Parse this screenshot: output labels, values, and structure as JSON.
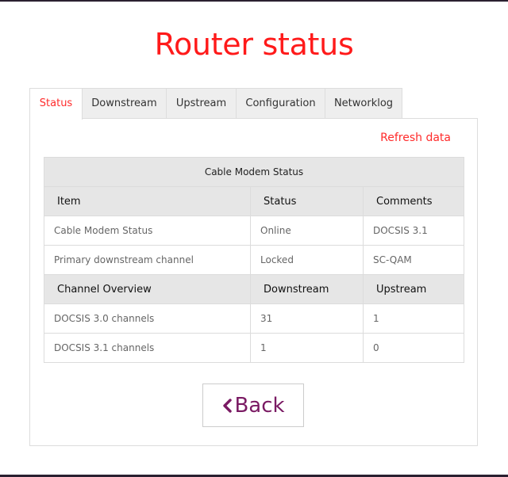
{
  "page": {
    "title": "Router status"
  },
  "tabs": [
    {
      "label": "Status",
      "active": true
    },
    {
      "label": "Downstream",
      "active": false
    },
    {
      "label": "Upstream",
      "active": false
    },
    {
      "label": "Configuration",
      "active": false
    },
    {
      "label": "Networklog",
      "active": false
    }
  ],
  "panel": {
    "refresh_label": "Refresh data"
  },
  "modem_table": {
    "caption": "Cable Modem Status",
    "headers": [
      "Item",
      "Status",
      "Comments"
    ],
    "rows": [
      [
        "Cable Modem Status",
        "Online",
        "DOCSIS 3.1"
      ],
      [
        "Primary downstream channel",
        "Locked",
        "SC-QAM"
      ]
    ]
  },
  "channel_table": {
    "headers": [
      "Channel Overview",
      "Downstream",
      "Upstream"
    ],
    "rows": [
      [
        "DOCSIS 3.0 channels",
        "31",
        "1"
      ],
      [
        "DOCSIS 3.1 channels",
        "1",
        "0"
      ]
    ]
  },
  "back_button": {
    "label": "Back",
    "icon": "chevron-left-icon"
  },
  "colors": {
    "accent": "#ff1a1a",
    "button_text": "#7a1a63",
    "header_bg": "#e6e6e6",
    "tab_bg": "#eeeeee"
  }
}
